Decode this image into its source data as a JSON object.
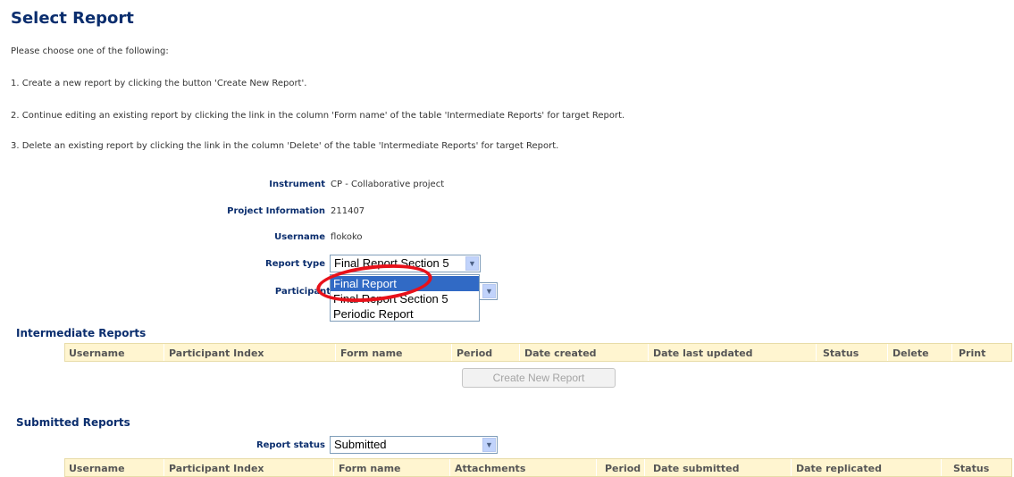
{
  "page": {
    "title": "Select Report",
    "intro": "Please choose one of the following:",
    "instructions": [
      "1. Create a new report by clicking the button 'Create New Report'.",
      "2. Continue editing an existing report by clicking the link in the column 'Form name' of the table 'Intermediate Reports' for target Report.",
      "3. Delete an existing report by clicking the link in the column 'Delete' of the table 'Intermediate Reports' for target Report."
    ]
  },
  "form": {
    "instrument_label": "Instrument",
    "instrument_value": "CP - Collaborative project",
    "project_label": "Project Information",
    "project_value": "211407",
    "username_label": "Username",
    "username_value": "flokoko",
    "report_type_label": "Report type",
    "report_type_value": "Final Report Section 5",
    "participant_label": "Participant",
    "report_type_options": [
      "Final Report",
      "Final Report Section 5",
      "Periodic Report"
    ],
    "highlighted_option": "Final Report"
  },
  "intermediate": {
    "title": "Intermediate Reports",
    "columns": [
      "Username",
      "Participant Index",
      "Form name",
      "Period",
      "Date created",
      "Date last updated",
      "Status",
      "Delete",
      "Print"
    ],
    "create_button": "Create New Report"
  },
  "submitted": {
    "title": "Submitted Reports",
    "status_label": "Report status",
    "status_value": "Submitted",
    "columns": [
      "Username",
      "Participant Index",
      "Form name",
      "Attachments",
      "Period",
      "Date submitted",
      "Date replicated",
      "Status"
    ]
  },
  "colors": {
    "heading": "#0b2e6e",
    "table_header_bg": "#fff5d0",
    "selection": "#316ac5",
    "annotation": "#e8111a"
  },
  "icons": {
    "select_arrow": "chevron-down-icon"
  }
}
